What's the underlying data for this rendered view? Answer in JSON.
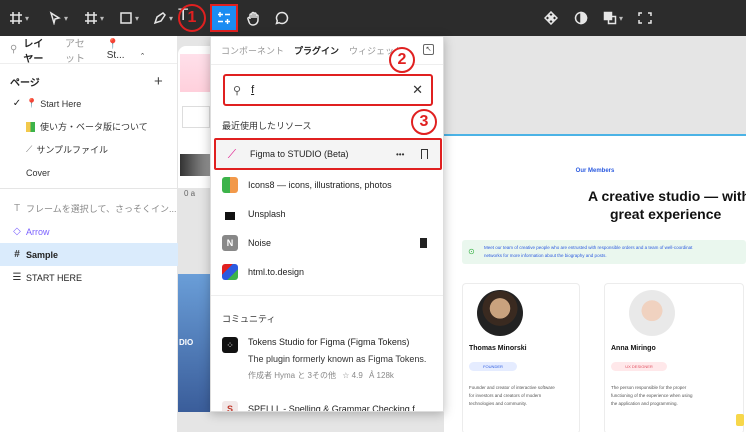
{
  "toolbar": {
    "annotation_1": "1"
  },
  "sidebar": {
    "tabs": [
      "レイヤー",
      "アセット",
      "St..."
    ],
    "pages_title": "ページ",
    "add_label": "+",
    "pages": [
      "Start Here",
      "使い方・ベータ版について",
      "サンプルファイル",
      "Cover"
    ],
    "layers": [
      "フレームを選択して、さっそくイン...",
      "Arrow",
      "Sample",
      "START HERE"
    ]
  },
  "panel": {
    "tabs": [
      "コンポーネント",
      "プラグイン",
      "ウィジェット"
    ],
    "annotation_2": "2",
    "annotation_3": "3",
    "search_value": "f",
    "recent_title": "最近使用したリソース",
    "recent": [
      {
        "name": "Figma to STUDIO (Beta)",
        "icon": "pen-icon"
      },
      {
        "name": "Icons8 — icons, illustrations, photos",
        "icon": "icons8-icon"
      },
      {
        "name": "Unsplash",
        "icon": "unsplash-icon"
      },
      {
        "name": "Noise",
        "icon": "noise-icon",
        "letter": "N"
      },
      {
        "name": "html.to.design",
        "icon": "html-icon"
      }
    ],
    "more_label": "•••",
    "community_title": "コミュニティ",
    "community": [
      {
        "name": "Tokens Studio for Figma (Figma Tokens)",
        "desc": "The plugin formerly known as Figma Tokens.",
        "meta_author": "作成者 Hyma と 3その他",
        "meta_rating": "☆ 4.9",
        "meta_users": "Ả 128k"
      },
      {
        "name": "SPELLL - Spelling & Grammar Checking f...",
        "letter": "S"
      }
    ]
  },
  "canvas": {
    "left_digits": "0  a",
    "left_text": "DIO"
  },
  "site": {
    "label": "Our Members",
    "heading_1": "A creative studio — with",
    "heading_2": "great experience",
    "notice_1": "Meet our team of creative people who are entrusted with responsible orders and a team of well-coordinat",
    "notice_2": "networks for more information about the biography and posts.",
    "members": [
      {
        "name": "Thomas Minorski",
        "role": "FOUNDER",
        "desc": [
          "Founder and creator of interactive software",
          "for investors and creators of modern",
          "technologies and community."
        ]
      },
      {
        "name": "Anna Miringo",
        "role": "UX DESIGNER",
        "desc": [
          "The person responsible for the proper",
          "functioning of the experience when using",
          "the application and programming."
        ]
      }
    ]
  },
  "colors": {
    "accent": "#1b8cf2",
    "annotation": "#e02020",
    "toolbar": "#2c2c2c"
  }
}
